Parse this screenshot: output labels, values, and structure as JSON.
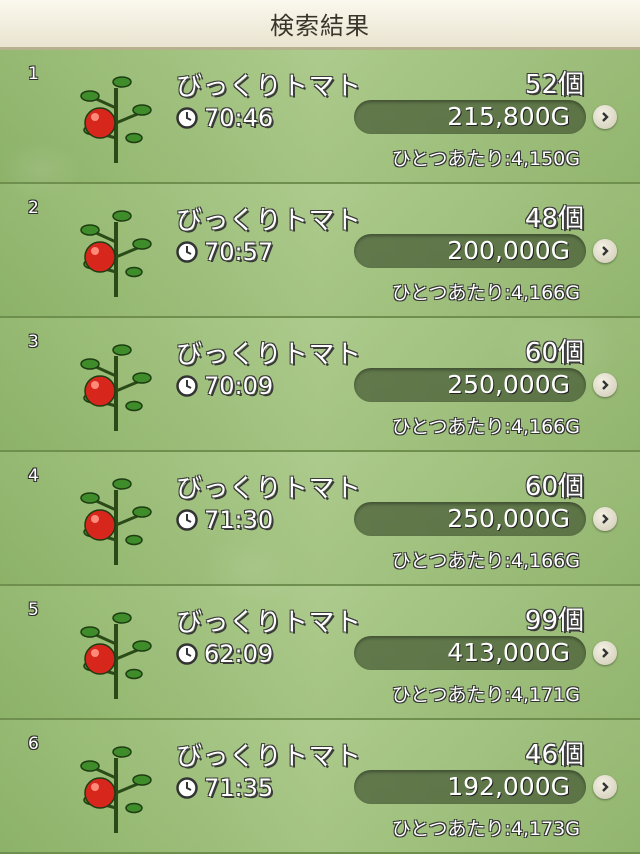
{
  "header": {
    "title": "検索結果"
  },
  "results": [
    {
      "index": "1",
      "name": "びっくりトマト",
      "time": "70:46",
      "quantity": "52個",
      "price": "215,800G",
      "unit_price": "ひとつあたり:4,150G"
    },
    {
      "index": "2",
      "name": "びっくりトマト",
      "time": "70:57",
      "quantity": "48個",
      "price": "200,000G",
      "unit_price": "ひとつあたり:4,166G"
    },
    {
      "index": "3",
      "name": "びっくりトマト",
      "time": "70:09",
      "quantity": "60個",
      "price": "250,000G",
      "unit_price": "ひとつあたり:4,166G"
    },
    {
      "index": "4",
      "name": "びっくりトマト",
      "time": "71:30",
      "quantity": "60個",
      "price": "250,000G",
      "unit_price": "ひとつあたり:4,166G"
    },
    {
      "index": "5",
      "name": "びっくりトマト",
      "time": "62:09",
      "quantity": "99個",
      "price": "413,000G",
      "unit_price": "ひとつあたり:4,171G"
    },
    {
      "index": "6",
      "name": "びっくりトマト",
      "time": "71:35",
      "quantity": "46個",
      "price": "192,000G",
      "unit_price": "ひとつあたり:4,173G"
    }
  ],
  "icons": {
    "item": "tomato-plant-icon",
    "time": "clock-icon",
    "detail": "chevron-right-icon"
  },
  "colors": {
    "background": "#9fc07a",
    "header": "#f5f1e2",
    "pill": "#3c4e2c",
    "tomato": "#d7261b",
    "leaf": "#2f7a24"
  }
}
